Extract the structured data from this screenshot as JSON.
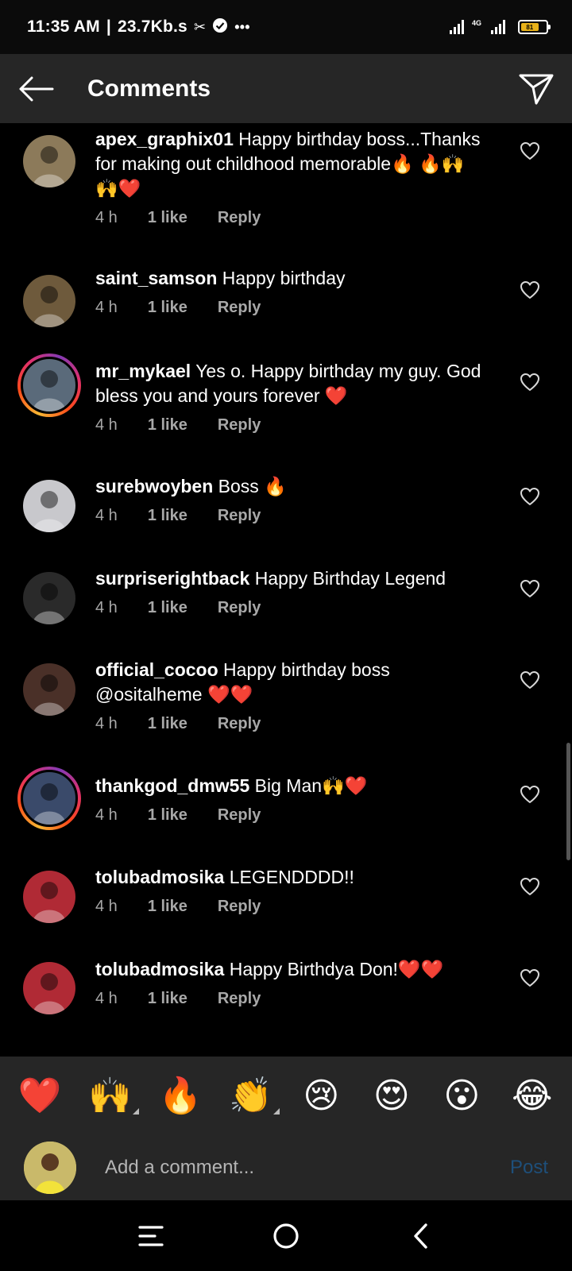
{
  "status_bar": {
    "time": "11:35 AM",
    "separator": "|",
    "speed": "23.7Kb.s",
    "icons": [
      "scissors-icon",
      "check-badge-icon",
      "more-dots-icon"
    ],
    "network_label": "4G",
    "battery_level": "81"
  },
  "header": {
    "title": "Comments",
    "back_icon": "arrow-left-icon",
    "send_icon": "paper-plane-icon"
  },
  "comments": [
    {
      "username": "apex_graphix01",
      "text": "Happy birthday boss...Thanks for making out childhood memorable🔥 🔥🙌🙌❤️",
      "time": "4 h",
      "likes": "1 like",
      "reply": "Reply",
      "story_ring": false,
      "avatar_color": "#8c7a5a"
    },
    {
      "username": "saint_samson",
      "text": "Happy birthday",
      "time": "4 h",
      "likes": "1 like",
      "reply": "Reply",
      "story_ring": false,
      "avatar_color": "#6e5a3c"
    },
    {
      "username": "mr_mykael",
      "text": "Yes o. Happy birthday my guy. God bless you and yours forever ❤️",
      "time": "4 h",
      "likes": "1 like",
      "reply": "Reply",
      "story_ring": true,
      "avatar_color": "#5a6a7a"
    },
    {
      "username": "surebwoyben",
      "text": "Boss 🔥",
      "time": "4 h",
      "likes": "1 like",
      "reply": "Reply",
      "story_ring": false,
      "avatar_color": "#c8c8cc"
    },
    {
      "username": "surpriserightback",
      "text": "Happy Birthday Legend",
      "time": "4 h",
      "likes": "1 like",
      "reply": "Reply",
      "story_ring": false,
      "avatar_color": "#2a2a2a"
    },
    {
      "username": "official_cocoo",
      "text": "Happy birthday boss @ositalheme ❤️❤️",
      "time": "4 h",
      "likes": "1 like",
      "reply": "Reply",
      "story_ring": false,
      "avatar_color": "#4a3028"
    },
    {
      "username": "thankgod_dmw55",
      "text": "Big Man🙌❤️",
      "time": "4 h",
      "likes": "1 like",
      "reply": "Reply",
      "story_ring": true,
      "avatar_color": "#3a4a6a"
    },
    {
      "username": "tolubadmosika",
      "text": "LEGENDDDD!!",
      "time": "4 h",
      "likes": "1 like",
      "reply": "Reply",
      "story_ring": false,
      "avatar_color": "#b02a35"
    },
    {
      "username": "tolubadmosika",
      "text": "Happy Birthdya Don!❤️❤️",
      "time": "4 h",
      "likes": "1 like",
      "reply": "Reply",
      "story_ring": false,
      "avatar_color": "#b02a35"
    }
  ],
  "reactions": [
    {
      "emoji": "❤️",
      "has_variants": false
    },
    {
      "emoji": "🙌",
      "has_variants": true
    },
    {
      "emoji": "🔥",
      "has_variants": false
    },
    {
      "emoji": "👏",
      "has_variants": true
    },
    {
      "emoji": "😢",
      "has_variants": false
    },
    {
      "emoji": "😍",
      "has_variants": false
    },
    {
      "emoji": "😮",
      "has_variants": false
    },
    {
      "emoji": "😂",
      "has_variants": false
    }
  ],
  "composer": {
    "placeholder": "Add a comment...",
    "post_label": "Post"
  },
  "nav_bar": {
    "icons": [
      "menu-icon",
      "home-icon",
      "back-icon"
    ]
  }
}
